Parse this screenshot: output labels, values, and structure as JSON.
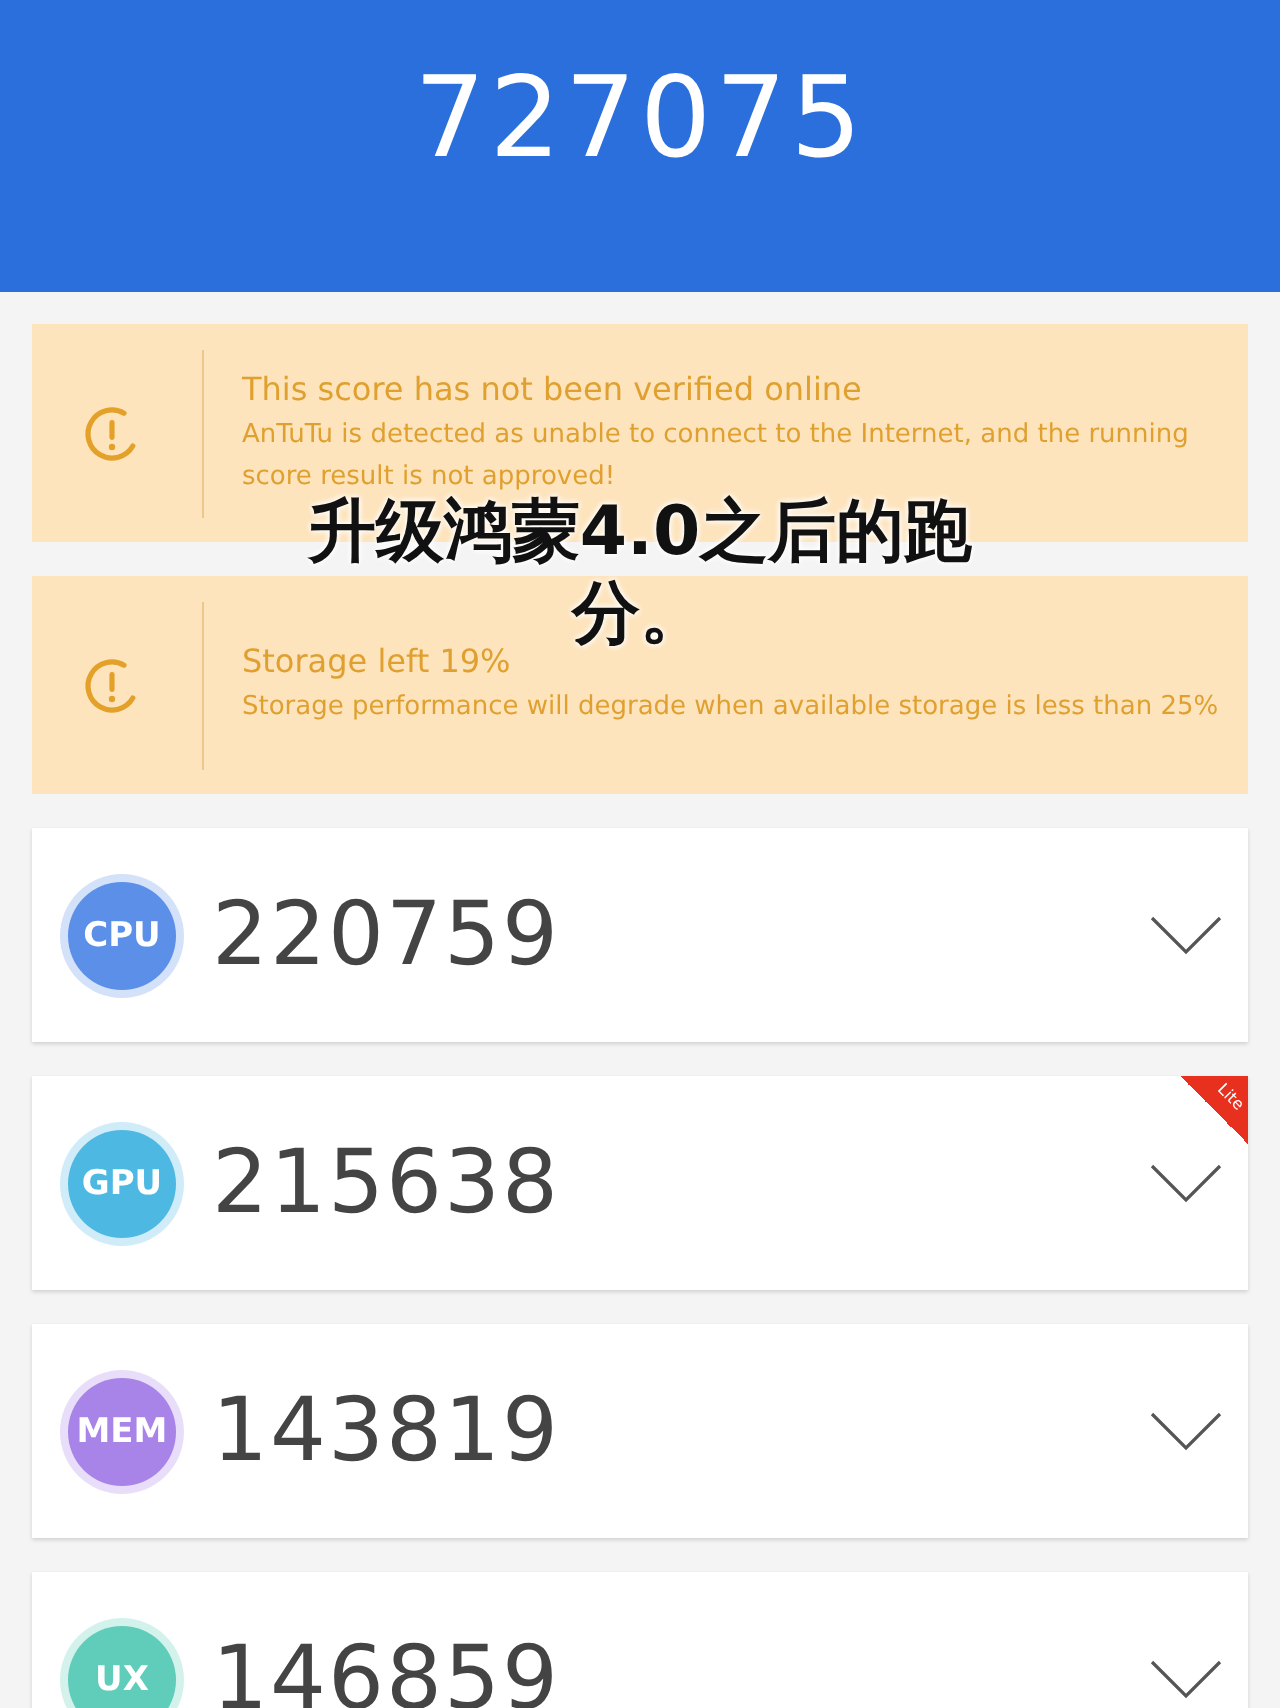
{
  "header": {
    "total_score": "727075"
  },
  "notices": [
    {
      "title": "This score has not been verified online",
      "text": "AnTuTu is detected as unable to connect to the Internet, and the running score result is not approved!"
    },
    {
      "title": "Storage left 19%",
      "text": "Storage performance will degrade when available storage is less than 25%"
    }
  ],
  "scores": [
    {
      "label": "CPU",
      "score": "220759",
      "color": "#5b8fe8"
    },
    {
      "label": "GPU",
      "score": "215638",
      "color": "#4db9e3",
      "ribbon": "Lite"
    },
    {
      "label": "MEM",
      "score": "143819",
      "color": "#a884e8"
    },
    {
      "label": "UX",
      "score": "146859",
      "color": "#5fcdb9"
    }
  ],
  "caption": "升级鸿蒙4.0之后的跑分。"
}
